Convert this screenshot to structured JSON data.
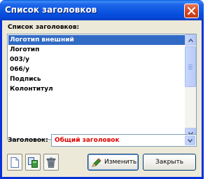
{
  "window": {
    "title": "Список заголовков"
  },
  "list": {
    "label": "Список заголовков:",
    "items": [
      "Логотип внешний",
      "Логотип",
      "003/у",
      "066/у",
      "Подпись",
      "Колонтитул"
    ],
    "selected_index": 0
  },
  "heading_field": {
    "label": "Заголовок:",
    "value": "Общий заголовок"
  },
  "buttons": {
    "change_label": "Изменить",
    "close_label": "Закрыть"
  },
  "toolbar": {
    "icons": [
      "new-document-icon",
      "copy-document-icon",
      "trash-can-icon"
    ]
  },
  "colors": {
    "title_bar": "#0a53e0",
    "selection": "#316ac5",
    "heading_value": "#e00000",
    "dialog_background": "#ece9d8"
  }
}
